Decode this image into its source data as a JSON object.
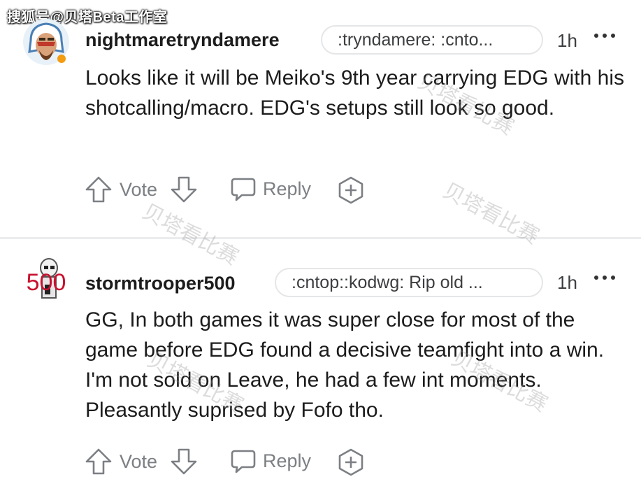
{
  "watermark_top": "搜狐号@贝塔Beta工作室",
  "watermark_diag": "贝塔看比赛",
  "comments": [
    {
      "username": "nightmaretryndamere",
      "flair": ":tryndamere: :cnto...",
      "time": "1h",
      "body": "Looks like it will be Meiko's 9th year carrying EDG with his shotcalling/macro. EDG's setups still look so good.",
      "vote_label": "Vote",
      "reply_label": "Reply"
    },
    {
      "username": "stormtrooper500",
      "avatar_text": "500",
      "flair": ":cntop::kodwg: Rip old ...",
      "time": "1h",
      "body": "GG, In both games it was super close for most of the game before EDG found a decisive teamfight into a win. I'm not sold on Leave, he had a few int moments. Pleasantly suprised by Fofo tho.",
      "vote_label": "Vote",
      "reply_label": "Reply"
    }
  ],
  "colors": {
    "accent_500": "#c8102e",
    "divider": "#ebeced",
    "meta": "#7c7f83"
  },
  "icons": [
    "upvote-icon",
    "downvote-icon",
    "reply-icon",
    "award-icon",
    "more-options-icon"
  ]
}
